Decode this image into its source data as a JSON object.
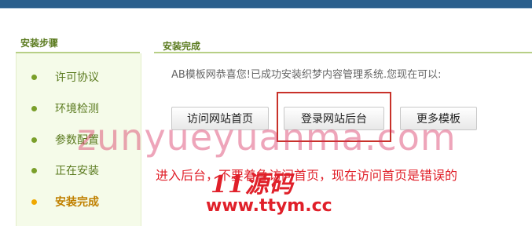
{
  "sidebar": {
    "title": "安装步骤",
    "steps": [
      {
        "label": "许可协议"
      },
      {
        "label": "环境检测"
      },
      {
        "label": "参数配置"
      },
      {
        "label": "正在安装"
      },
      {
        "label": "安装完成"
      }
    ]
  },
  "main": {
    "title": "安装完成",
    "message": "AB模板网恭喜您!已成功安装织梦内容管理系统.您现在可以:",
    "buttons": {
      "home": "访问网站首页",
      "admin": "登录网站后台",
      "more": "更多模板"
    }
  },
  "overlay": {
    "watermark": "zunyueyuanma.com",
    "annotation": "进入后台，不要着急访问首页，现在访问首页是错误的",
    "logo_text": "11源码",
    "logo_url": "www.ttym.cc"
  },
  "colors": {
    "accent_green": "#5a7a1e",
    "active_step": "#c08000",
    "annotation_red": "#e0202a",
    "header_blue": "#2a5f8d"
  }
}
